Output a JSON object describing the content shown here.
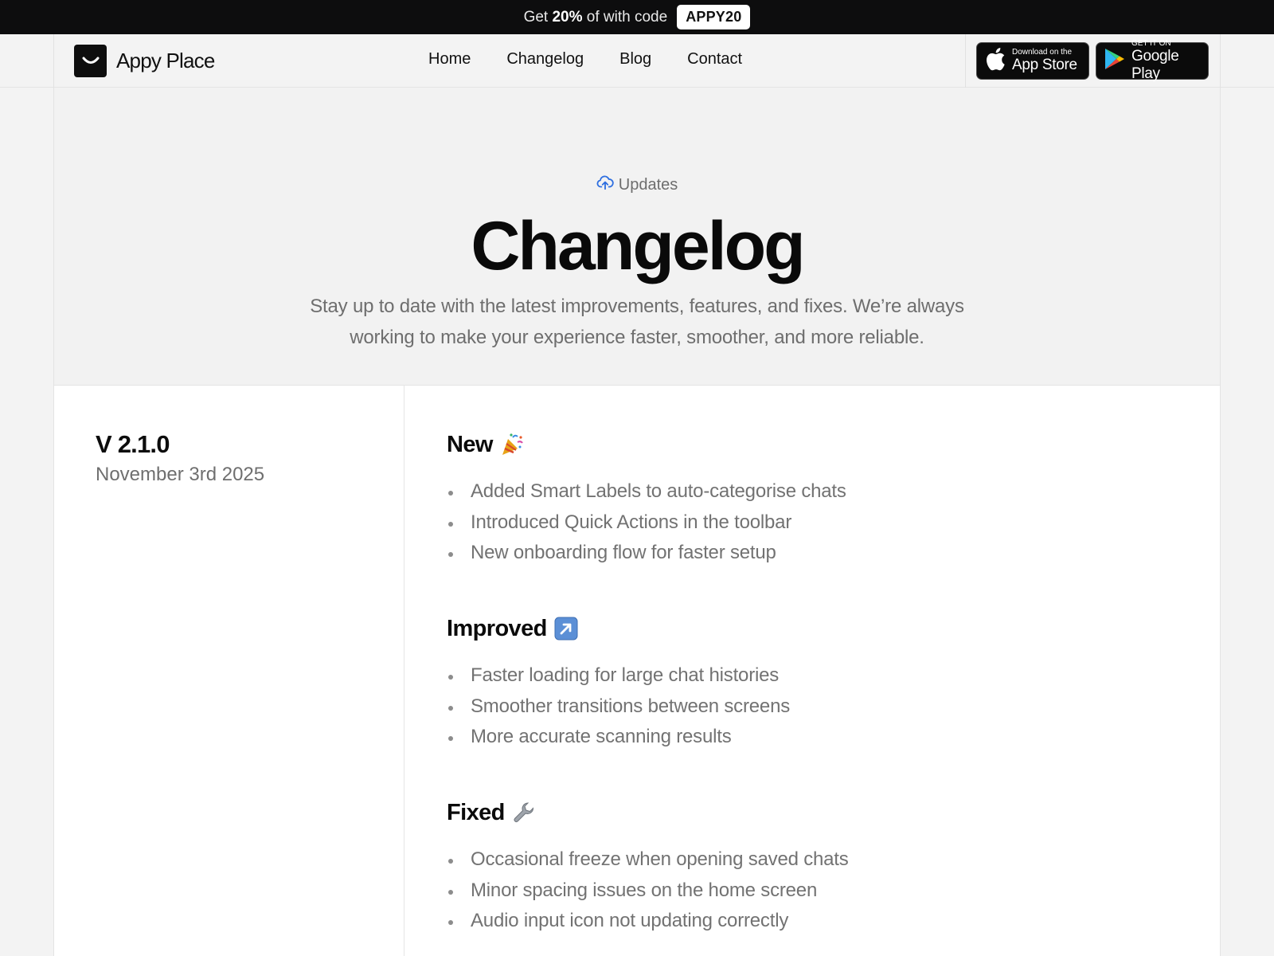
{
  "promo": {
    "prefix": "Get",
    "discount": "20%",
    "suffix": "of with code",
    "code": "APPY20"
  },
  "brand": {
    "name": "Appy Place"
  },
  "nav": {
    "links": [
      {
        "label": "Home"
      },
      {
        "label": "Changelog"
      },
      {
        "label": "Blog"
      },
      {
        "label": "Contact"
      }
    ]
  },
  "stores": {
    "apple": {
      "small": "Download on the",
      "big": "App Store",
      "icon": "apple-icon"
    },
    "google": {
      "small": "GET IT ON",
      "big": "Google Play",
      "icon": "google-play-icon"
    }
  },
  "hero": {
    "eyebrow": "Updates",
    "eyebrow_icon": "cloud-upload-icon",
    "title": "Changelog",
    "subtitle": "Stay up to date with the latest improvements, features, and fixes. We’re always working to make your experience faster, smoother, and more reliable."
  },
  "release": {
    "version": "V 2.1.0",
    "date": "November 3rd 2025",
    "sections": [
      {
        "title": "New",
        "icon": "party-popper-icon",
        "items": [
          "Added Smart Labels to auto-categorise chats",
          "Introduced Quick Actions in the toolbar",
          "New onboarding flow for faster setup"
        ]
      },
      {
        "title": "Improved",
        "icon": "up-right-arrow-icon",
        "items": [
          "Faster loading for large chat histories",
          "Smoother transitions between screens",
          "More accurate scanning results"
        ]
      },
      {
        "title": "Fixed",
        "icon": "wrench-icon",
        "items": [
          "Occasional freeze when opening saved chats",
          "Minor spacing issues on the home screen",
          "Audio input icon not updating correctly"
        ]
      }
    ]
  },
  "colors": {
    "banner_bg": "#0d0d0e",
    "page_bg": "#f3f3f3",
    "accent_blue": "#2f6fe0",
    "muted_text": "#6e6e6e"
  }
}
